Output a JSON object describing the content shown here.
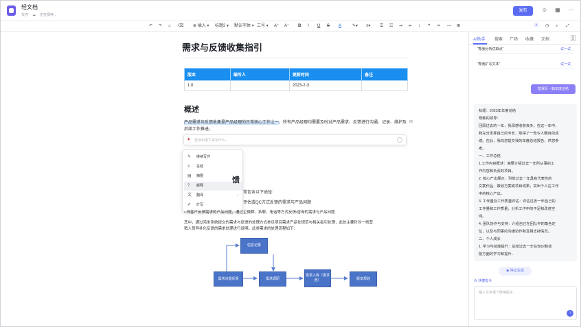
{
  "header": {
    "doc_title": "轻文档",
    "meta_file": "文件",
    "meta_status": "正在保存...",
    "publish_label": "发布"
  },
  "toolbar": {
    "insert": "插入",
    "heading": "标题2",
    "font": "默认字体",
    "size": "三号",
    "bold": "B",
    "italic": "I",
    "underline": "U",
    "strike": "S",
    "color_a": "A"
  },
  "doc": {
    "title": "需求与反馈收集指引",
    "table": {
      "headers": [
        "版本",
        "编写人",
        "更新时间",
        "备注"
      ],
      "rows": [
        [
          "1.0",
          "",
          "2023-2-3",
          ""
        ]
      ]
    },
    "section1": "概述",
    "para_hl": "产品需求与反馈收集是产品经理的日常核心工作之一",
    "para_rest": "，所有产品经理均需要及时对产品需求、反馈进行沟通、记录、维护及后续工作推进。",
    "section2": "馈",
    "l1": "常包含以下途径：",
    "l2": "评估或QC方式反馈的需求与产品问题",
    "l3": "• 线客户反馈需求的产品问题，通过企微群、私聊、电话等方式反馈/咨询的需求与产品问题",
    "l4": "其中，通过鸿米系统提交的需求与反馈的处理方式参见项目需求产品化规范与相关指引处理，此处主要针对一线营",
    "l5": "销人员异补化反馈的需求处理进行说明。此类需求的处理流程如下："
  },
  "ai_bar": {
    "placeholder": "告诉AI接下来写什么..."
  },
  "menu": {
    "items": [
      {
        "icon": "✎",
        "label": "继续写作"
      },
      {
        "icon": "≡",
        "label": "总结"
      },
      {
        "icon": "▤",
        "label": "摘要"
      },
      {
        "icon": "?",
        "label": "解释"
      },
      {
        "icon": "文",
        "label": "翻译"
      },
      {
        "icon": "✐",
        "label": "扩写"
      }
    ]
  },
  "flow": {
    "review": "信息记录",
    "feedback": "需求点题反馈",
    "research": "需求调研",
    "pool": "需求入库（需求池）",
    "plan": "版本规划"
  },
  "right_panel": {
    "tabs": [
      "AI助手",
      "搜索",
      "广场",
      "收藏",
      "文档"
    ],
    "prompts": [
      {
        "text": "“帮我分析优缺点”",
        "try": "试一试"
      },
      {
        "text": "“帮我扩写文本”",
        "try": "试一试"
      }
    ],
    "user_msg": "帮我写一篇年度总结",
    "response": [
      "标题：2023年年度总结",
      "尊敬的领导：",
      "回顾过去的一年，我深感收获良多。在这一年中，",
      "我充分发挥自己的专长，取得了一些令人瞩目的成",
      "绩。在此，我向您提交我的年度总结报告，供您参",
      "考。",
      "一、工作总结",
      "1.工作内容概述：简要介绍过去一年所从事的工",
      "作内容和负责的项目。",
      "2. 核心产出展示：列举过去一年具有代表性的",
      "文案作品、策划方案或项目成果，突出个人在工作",
      "中的核心产出。",
      "3. 工作量及工作质量评估：评估过去一年自己的",
      "工作量和工作质量，分析工作中的不足和改进空",
      "间。",
      "4. 团队协作与支持：介绍自己在团队中的角色定",
      "位，以及与同事的沟通协作和互相支持情况。",
      "二、个人成长",
      "1. 学习与技能提升：总结过去一年在知识和技",
      "能方面的学习和提升.."
    ],
    "stop_label": "停止生成",
    "quick_cmd": "快捷指令",
    "input_placeholder": "输入文字或“/”使用指令..."
  }
}
